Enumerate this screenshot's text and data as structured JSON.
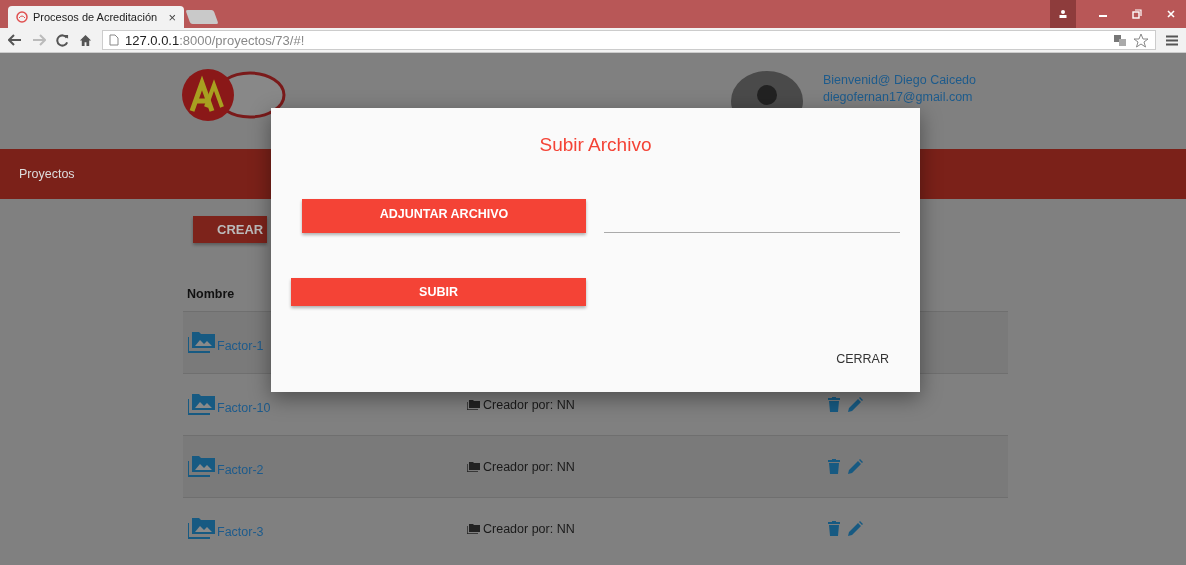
{
  "browser": {
    "tab_title": "Procesos de Acreditación",
    "tab_close": "×",
    "url_host": "127.0.0.1",
    "url_path": ":8000/proyectos/73/#!"
  },
  "header": {
    "greeting": "Bienvenid@ Diego Caicedo",
    "email": "diegofernan17@gmail.com"
  },
  "nav": {
    "items": [
      "Proyectos"
    ]
  },
  "create_button": "CREAR",
  "table": {
    "columns": [
      "Nombre"
    ],
    "rows": [
      {
        "name": "Factor-1"
      },
      {
        "name": "Factor-10",
        "creator": "Creador por: NN"
      },
      {
        "name": "Factor-2",
        "creator": "Creador por: NN"
      },
      {
        "name": "Factor-3",
        "creator": "Creador por: NN"
      }
    ]
  },
  "modal": {
    "title": "Subir Archivo",
    "attach_button": "ADJUNTAR ARCHIVO",
    "upload_button": "SUBIR",
    "close_button": "CERRAR"
  }
}
